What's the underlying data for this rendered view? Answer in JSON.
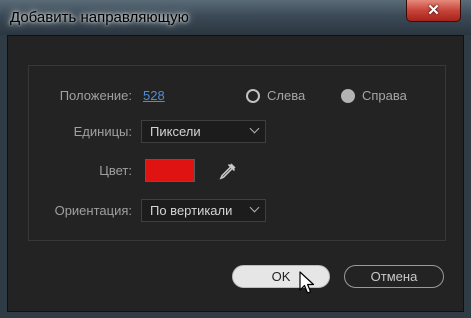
{
  "window": {
    "title": "Добавить направляющую",
    "close_glyph": "✕"
  },
  "form": {
    "position_label": "Положение:",
    "position_value": "528",
    "radio_left_label": "Слева",
    "radio_left_selected": false,
    "radio_right_label": "Справа",
    "radio_right_selected": true,
    "units_label": "Единицы:",
    "units_value": "Пиксели",
    "color_label": "Цвет:",
    "color_value": "#df1312",
    "orientation_label": "Ориентация:",
    "orientation_value": "По вертикали"
  },
  "buttons": {
    "ok_label": "OK",
    "cancel_label": "Отмена"
  },
  "icons": {
    "eyedropper": "eyedropper-icon",
    "cursor": "mouse-pointer-icon"
  }
}
